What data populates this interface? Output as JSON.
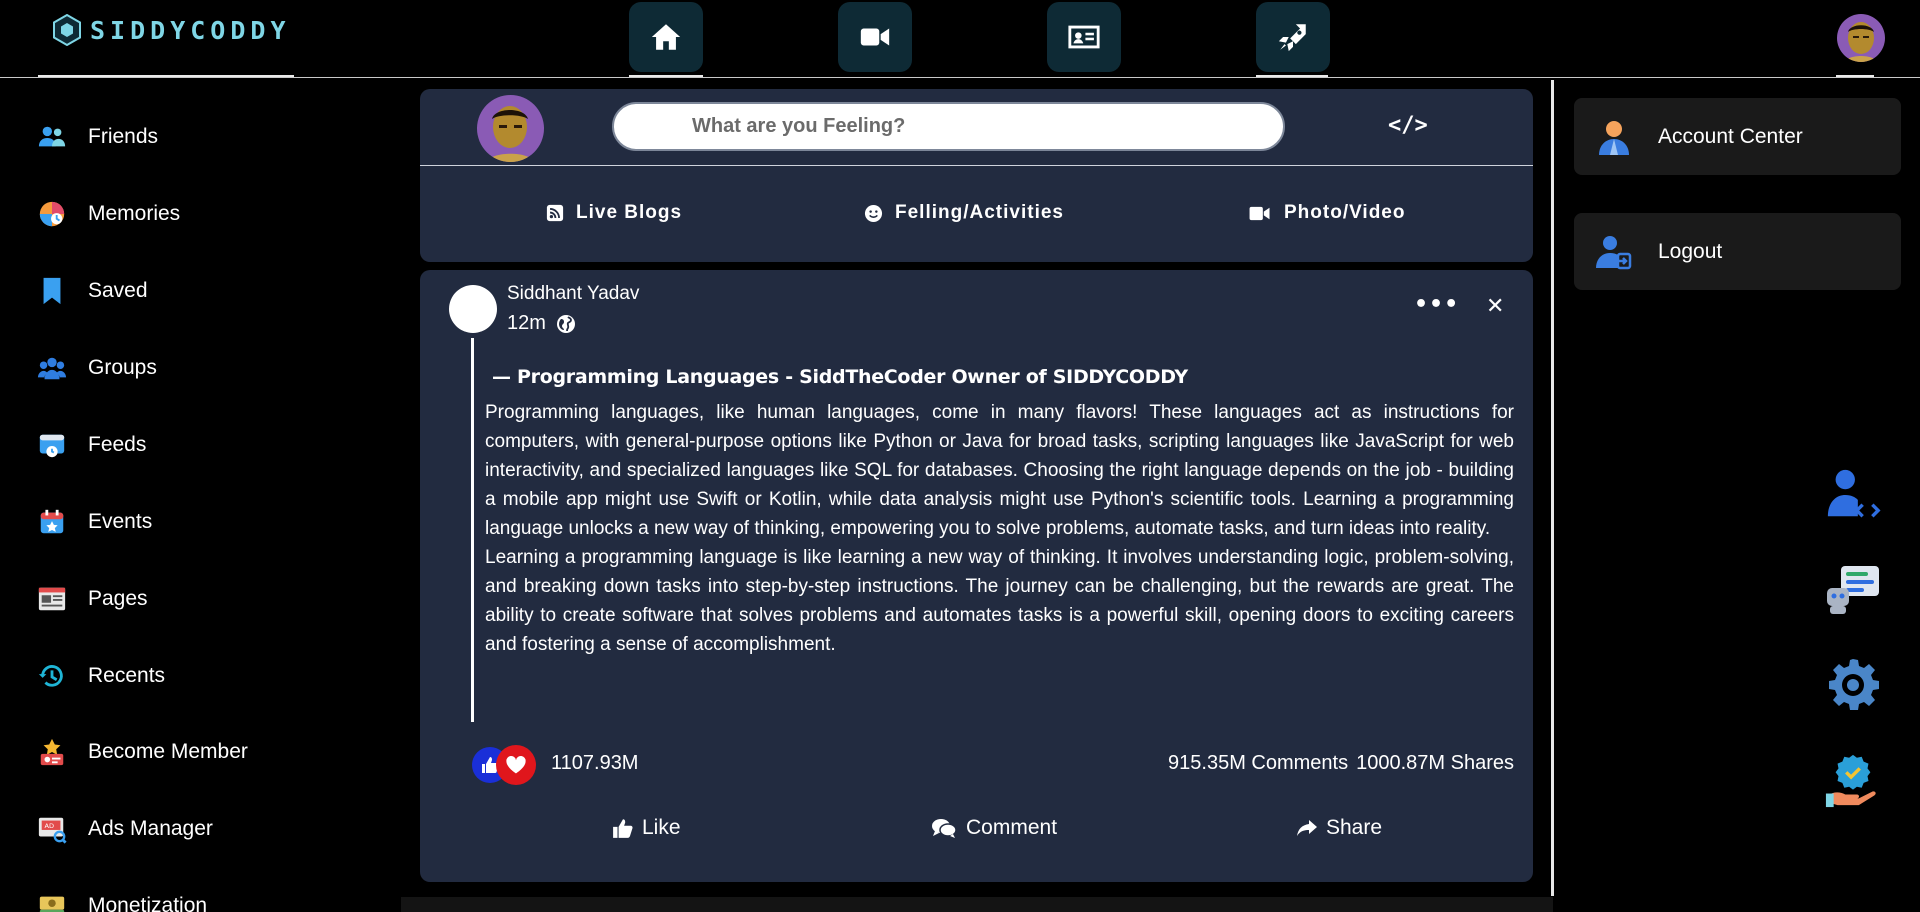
{
  "header": {
    "logo_text": "SIDDYCODDY",
    "nav": [
      {
        "icon": "home-icon"
      },
      {
        "icon": "video-camera-icon"
      },
      {
        "icon": "id-card-icon"
      },
      {
        "icon": "rocket-icon"
      }
    ]
  },
  "sidebar": {
    "items": [
      {
        "label": "Friends",
        "icon": "friends-icon"
      },
      {
        "label": "Memories",
        "icon": "memories-icon"
      },
      {
        "label": "Saved",
        "icon": "bookmark-icon"
      },
      {
        "label": "Groups",
        "icon": "groups-icon"
      },
      {
        "label": "Feeds",
        "icon": "feeds-icon"
      },
      {
        "label": "Events",
        "icon": "calendar-icon"
      },
      {
        "label": "Pages",
        "icon": "pages-icon"
      },
      {
        "label": "Recents",
        "icon": "history-icon"
      },
      {
        "label": "Become Member",
        "icon": "member-badge-icon"
      },
      {
        "label": "Ads Manager",
        "icon": "ads-manager-icon"
      },
      {
        "label": "Monetization",
        "icon": "money-icon"
      }
    ]
  },
  "composer": {
    "placeholder": "What are you Feeling?",
    "code_label": "</>",
    "actions": [
      {
        "label": "Live Blogs",
        "icon": "rss-icon"
      },
      {
        "label": "Felling/Activities",
        "icon": "smile-icon"
      },
      {
        "label": "Photo/Video",
        "icon": "video-icon"
      }
    ]
  },
  "post": {
    "author": "Siddhant Yadav",
    "time": "12m",
    "more_label": "•••",
    "close_label": "✕",
    "heading": "— Programming Languages - SiddTheCoder Owner of SIDDYCODDY",
    "paragraphs": [
      "Programming languages, like human languages, come in many flavors! These languages act as instructions for computers, with general-purpose options like Python or Java for broad tasks, scripting languages like JavaScript for web interactivity, and specialized languages like SQL for databases. Choosing the right language depends on the job - building a mobile app might use Swift or Kotlin, while data analysis might use Python's scientific tools. Learning a programming language unlocks a new way of thinking, empowering you to solve problems, automate tasks, and turn ideas into reality.",
      "Learning a programming language is like learning a new way of thinking. It involves understanding logic, problem-solving, and breaking down tasks into step-by-step instructions. The journey can be challenging, but the rewards are great. The ability to create software that solves problems and automates tasks is a powerful skill, opening doors to exciting careers and fostering a sense of accomplishment."
    ],
    "reaction_count": "1107.93M",
    "comments": "915.35M Comments",
    "shares": "1000.87M Shares",
    "actions": [
      {
        "label": "Like",
        "icon": "thumbs-up-icon"
      },
      {
        "label": "Comment",
        "icon": "comments-icon"
      },
      {
        "label": "Share",
        "icon": "share-icon"
      }
    ]
  },
  "right_panel": {
    "cards": [
      {
        "label": "Account Center",
        "icon": "account-icon"
      },
      {
        "label": "Logout",
        "icon": "logout-icon"
      }
    ],
    "floating": [
      "developer-icon",
      "chatbot-icon",
      "settings-gear-icon",
      "verified-hand-icon"
    ]
  },
  "colors": {
    "background": "#000000",
    "card": "#222b40",
    "nav_button": "#0e2a35",
    "logo": "#7fd6e6",
    "like_blue": "#1a2fd8",
    "love_red": "#e0161c"
  }
}
